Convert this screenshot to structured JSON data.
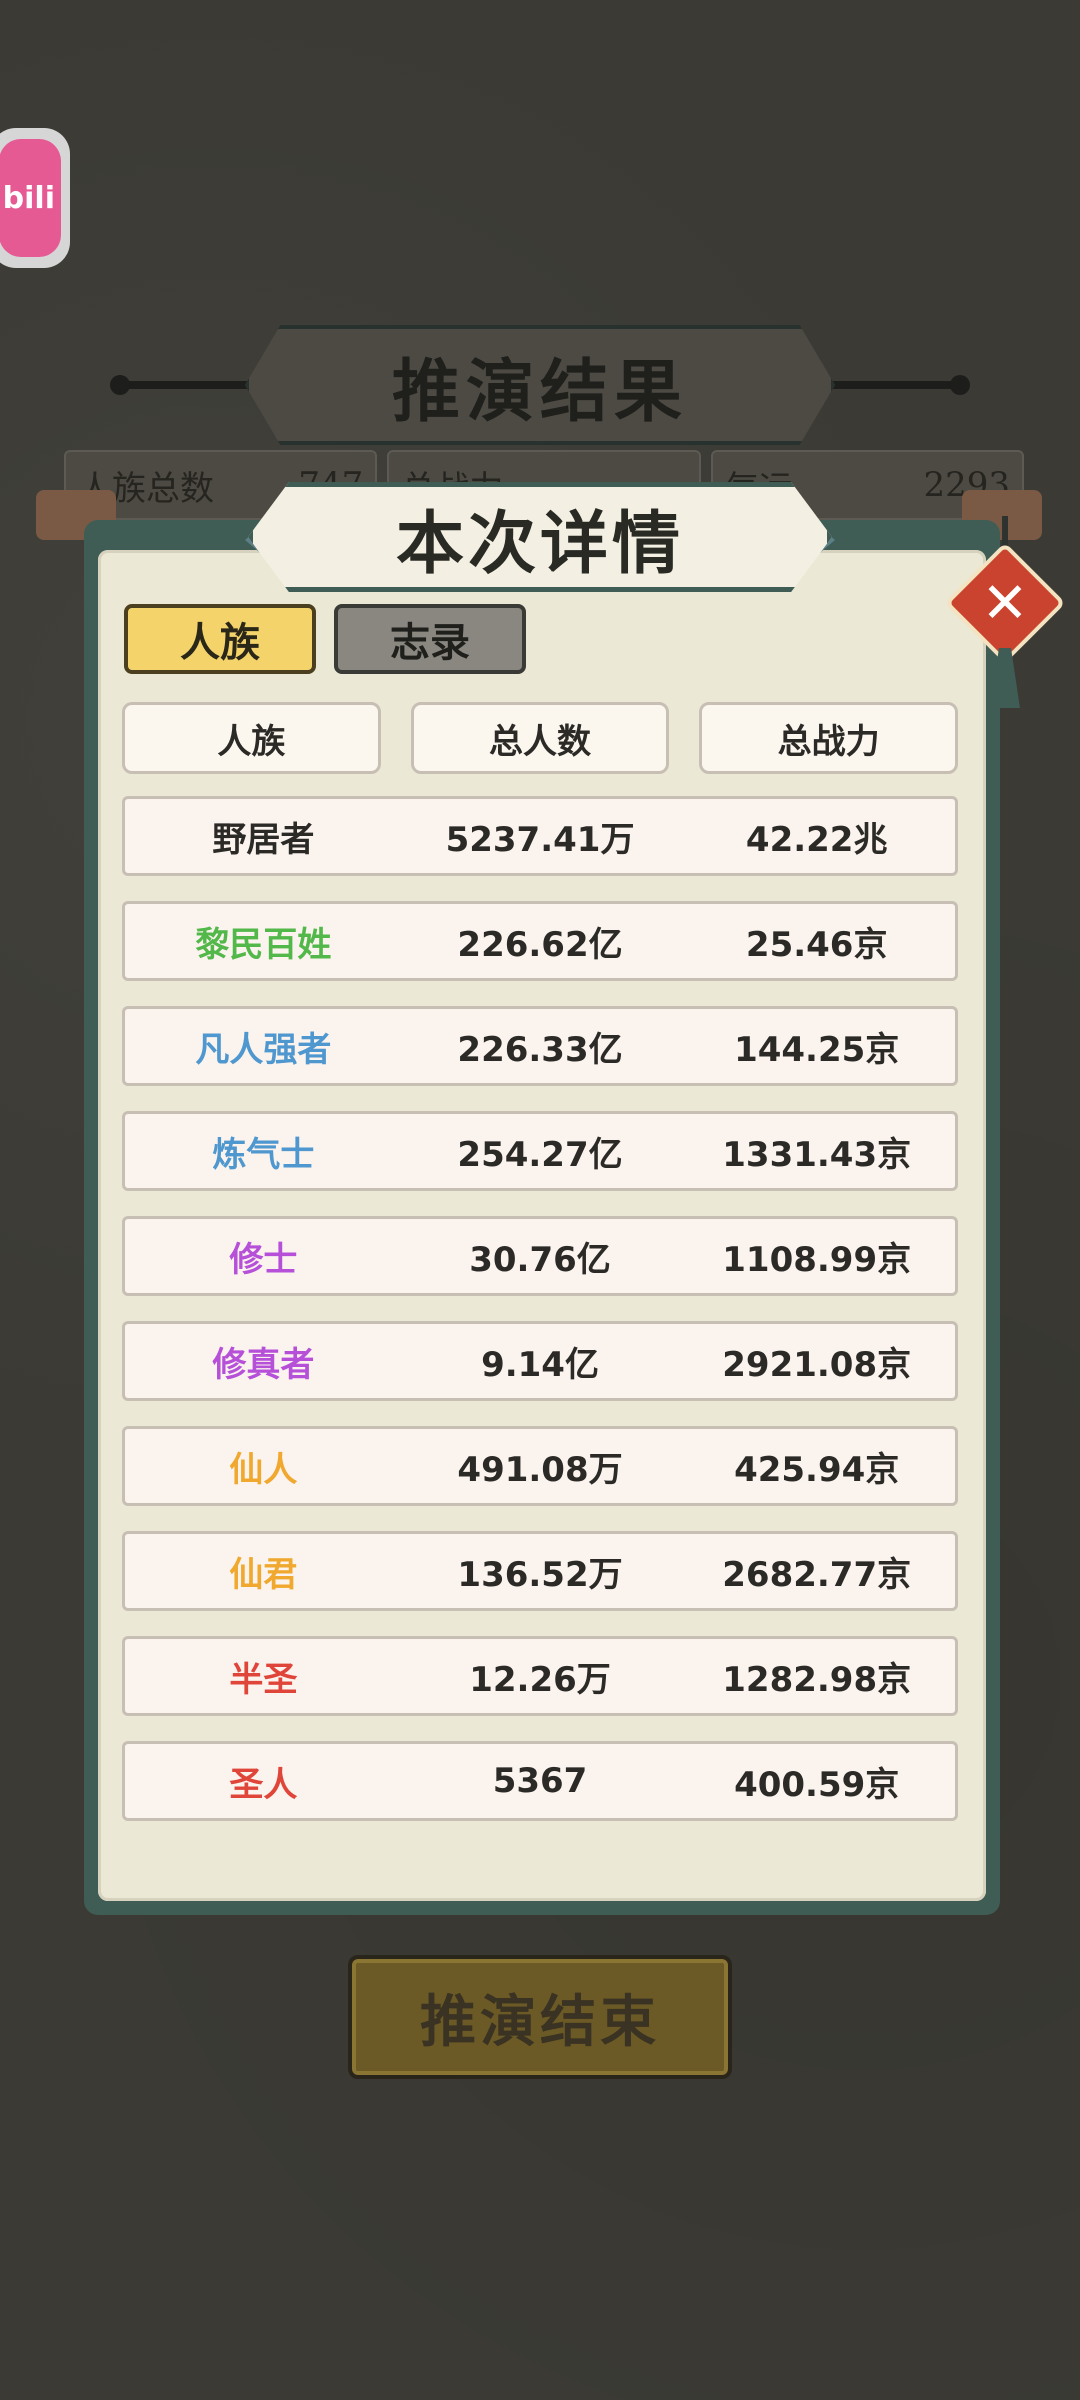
{
  "badge": {
    "label": "bili"
  },
  "background": {
    "title": "推演结果",
    "stats": [
      {
        "label": "人族总数",
        "value": "747"
      },
      {
        "label": "总战力",
        "value": ""
      },
      {
        "label": "气运",
        "value": "2293"
      }
    ]
  },
  "dialog": {
    "title": "本次详情",
    "tabs": [
      {
        "label": "人族",
        "active": true
      },
      {
        "label": "志录",
        "active": false
      }
    ],
    "columns": [
      "人族",
      "总人数",
      "总战力"
    ],
    "rows": [
      {
        "name": "野居者",
        "population": "5237.41万",
        "power": "42.22兆",
        "color": "#2b2a27"
      },
      {
        "name": "黎民百姓",
        "population": "226.62亿",
        "power": "25.46京",
        "color": "#53b84a"
      },
      {
        "name": "凡人强者",
        "population": "226.33亿",
        "power": "144.25京",
        "color": "#4f97cf"
      },
      {
        "name": "炼气士",
        "population": "254.27亿",
        "power": "1331.43京",
        "color": "#4f97cf"
      },
      {
        "name": "修士",
        "population": "30.76亿",
        "power": "1108.99京",
        "color": "#b650d8"
      },
      {
        "name": "修真者",
        "population": "9.14亿",
        "power": "2921.08京",
        "color": "#b650d8"
      },
      {
        "name": "仙人",
        "population": "491.08万",
        "power": "425.94京",
        "color": "#f0a82e"
      },
      {
        "name": "仙君",
        "population": "136.52万",
        "power": "2682.77京",
        "color": "#f0a82e"
      },
      {
        "name": "半圣",
        "population": "12.26万",
        "power": "1282.98京",
        "color": "#e0453a"
      },
      {
        "name": "圣人",
        "population": "5367",
        "power": "400.59京",
        "color": "#e0453a"
      }
    ]
  },
  "end_button": {
    "label": "推演结束"
  }
}
